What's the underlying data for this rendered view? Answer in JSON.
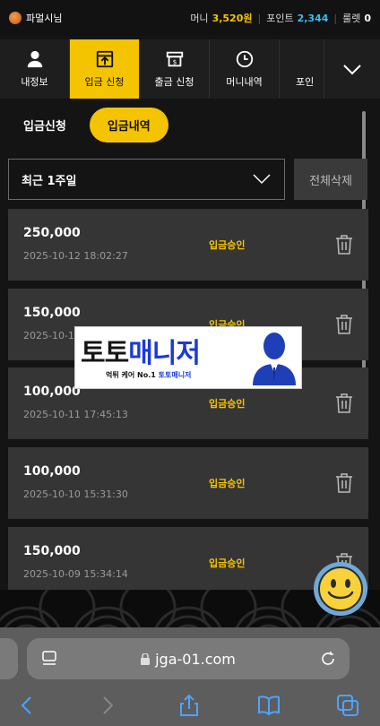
{
  "topbar": {
    "username": "파멀시님",
    "money_label": "머니",
    "money_value": "3,520원",
    "point_label": "포인트",
    "point_value": "2,344",
    "roulette_label": "룰렛",
    "roulette_value": "0"
  },
  "nav": {
    "items": [
      {
        "label": "내정보",
        "icon": "user-icon"
      },
      {
        "label": "입금 신청",
        "icon": "deposit-icon",
        "active": true
      },
      {
        "label": "출금 신청",
        "icon": "withdraw-icon"
      },
      {
        "label": "머니내역",
        "icon": "clock-icon"
      },
      {
        "label": "포인",
        "icon": "point-icon"
      }
    ],
    "more_icon": "chevron-down-icon"
  },
  "subtabs": {
    "request": "입금신청",
    "history": "입금내역"
  },
  "filter": {
    "selected": "최근 1주일",
    "delete_all": "전체삭제"
  },
  "deposits": [
    {
      "amount": "250,000",
      "date": "2025-10-12 18:02:27",
      "status": "입금승인"
    },
    {
      "amount": "150,000",
      "date": "2025-10-1",
      "status": "입금승인"
    },
    {
      "amount": "100,000",
      "date": "2025-10-11 17:45:13",
      "status": "입금승인"
    },
    {
      "amount": "100,000",
      "date": "2025-10-10 15:31:30",
      "status": "입금승인"
    },
    {
      "amount": "150,000",
      "date": "2025-10-09 15:34:14",
      "status": "입금승인"
    }
  ],
  "watermark": {
    "title_dark": "토토",
    "title_blue": "매니저",
    "sub_dark": "먹튀 케어 No.1",
    "sub_blue": "토토매니저"
  },
  "browser": {
    "url": "jga-01.com"
  },
  "colors": {
    "accent": "#f5c400",
    "point": "#35c0f0",
    "background": "#141414",
    "row": "#353535"
  }
}
